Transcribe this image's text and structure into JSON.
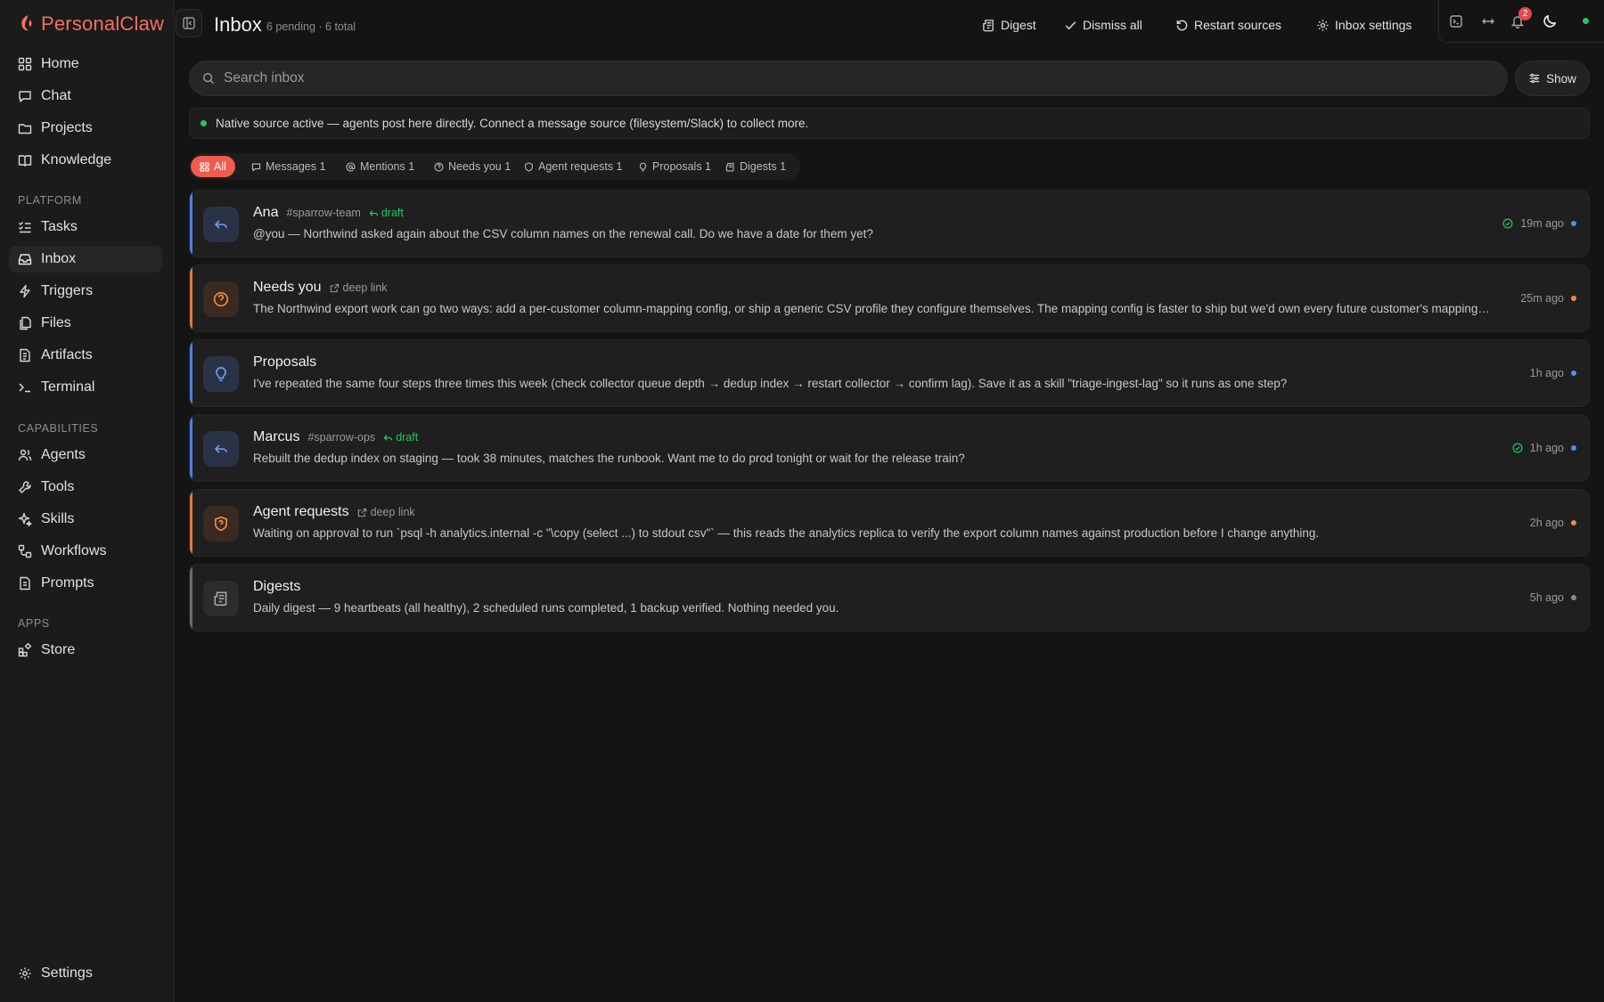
{
  "app": {
    "name": "PersonalClaw",
    "brand_color": "#f26f5e"
  },
  "sidebar": {
    "main": [
      {
        "label": "Home",
        "icon": "grid-icon"
      },
      {
        "label": "Chat",
        "icon": "chat-icon"
      },
      {
        "label": "Projects",
        "icon": "folder-icon"
      },
      {
        "label": "Knowledge",
        "icon": "book-icon"
      }
    ],
    "platform_heading": "PLATFORM",
    "platform": [
      {
        "label": "Tasks",
        "icon": "checklist-icon"
      },
      {
        "label": "Inbox",
        "icon": "inbox-icon",
        "active": true
      },
      {
        "label": "Triggers",
        "icon": "bolt-icon"
      },
      {
        "label": "Files",
        "icon": "files-icon"
      },
      {
        "label": "Artifacts",
        "icon": "box-icon"
      },
      {
        "label": "Terminal",
        "icon": "terminal-icon"
      }
    ],
    "capabilities_heading": "CAPABILITIES",
    "capabilities": [
      {
        "label": "Agents",
        "icon": "users-icon"
      },
      {
        "label": "Tools",
        "icon": "wrench-icon"
      },
      {
        "label": "Skills",
        "icon": "sparkles-icon"
      },
      {
        "label": "Workflows",
        "icon": "workflow-icon"
      },
      {
        "label": "Prompts",
        "icon": "prompt-icon"
      }
    ],
    "apps_heading": "APPS",
    "apps": [
      {
        "label": "Store",
        "icon": "store-icon"
      }
    ],
    "settings_label": "Settings"
  },
  "header": {
    "title": "Inbox",
    "subtitle": "6 pending · 6 total",
    "digest_label": "Digest",
    "dismiss_all_label": "Dismiss all",
    "restart_sources_label": "Restart sources",
    "inbox_settings_label": "Inbox settings",
    "notification_count": "2"
  },
  "search": {
    "placeholder": "Search inbox",
    "show_label": "Show"
  },
  "notice": {
    "text": "Native source active — agents post here directly. Connect a message source (filesystem/Slack) to collect more."
  },
  "tabs": [
    {
      "label": "All",
      "active": true
    },
    {
      "label": "Messages 1"
    },
    {
      "label": "Mentions 1"
    },
    {
      "label": "Needs you 1"
    },
    {
      "label": "Agent requests 1"
    },
    {
      "label": "Proposals 1"
    },
    {
      "label": "Digests 1"
    }
  ],
  "items": [
    {
      "name": "Ana",
      "channel": "#sparrow-team",
      "tag": "draft",
      "body": "@you — Northwind asked again about the CSV column names on the renewal call. Do we have a date for them yet?",
      "time": "19m ago",
      "accent": "#4f7fe0",
      "dot": "#4f8ff7"
    },
    {
      "name": "Needs you",
      "tag": "deep link",
      "body": "The Northwind export work can go two ways: add a per-customer column-mapping config, or ship a generic CSV profile they configure themselves. The mapping config is faster to ship but we'd own every future customer's mapping. What's your call?",
      "time": "25m ago",
      "accent": "#e07a3a",
      "dot": "#f08a3e"
    },
    {
      "name": "Proposals",
      "body": "I've repeated the same four steps three times this week (check collector queue depth → dedup index → restart collector → confirm lag). Save it as a skill \"triage-ingest-lag\" so it runs as one step?",
      "time": "1h ago",
      "accent": "#4f7fe0",
      "dot": "#4f8ff7"
    },
    {
      "name": "Marcus",
      "channel": "#sparrow-ops",
      "tag": "draft",
      "body": "Rebuilt the dedup index on staging — took 38 minutes, matches the runbook. Want me to do prod tonight or wait for the release train?",
      "time": "1h ago",
      "accent": "#4f7fe0",
      "dot": "#4f8ff7"
    },
    {
      "name": "Agent requests",
      "tag": "deep link",
      "body": "Waiting on approval to run `psql -h analytics.internal -c \"\\copy (select ...) to stdout csv\"` — this reads the analytics replica to verify the export column names against production before I change anything.",
      "time": "2h ago",
      "accent": "#e07a3a",
      "dot": "#f08a3e"
    },
    {
      "name": "Digests",
      "body": "Daily digest — 9 heartbeats (all healthy), 2 scheduled runs completed, 1 backup verified. Nothing needed you.",
      "time": "5h ago",
      "accent": "#6b6b6b",
      "dot": "#8a8a8a"
    }
  ]
}
